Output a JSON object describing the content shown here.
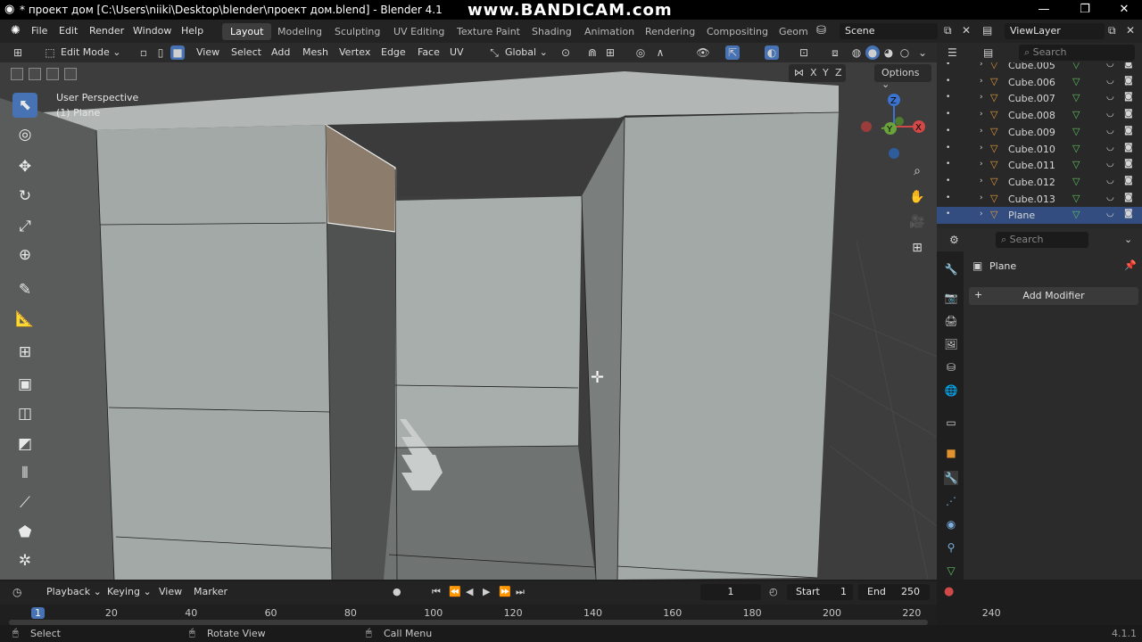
{
  "window": {
    "title": "* проект дом [C:\\Users\\niiki\\Desktop\\blender\\проект дом.blend] - Blender 4.1",
    "watermark": "www.BANDICAM.com"
  },
  "menu": [
    "File",
    "Edit",
    "Render",
    "Window",
    "Help"
  ],
  "workspaces": [
    "Layout",
    "Modeling",
    "Sculpting",
    "UV Editing",
    "Texture Paint",
    "Shading",
    "Animation",
    "Rendering",
    "Compositing",
    "Geom"
  ],
  "active_workspace": "Layout",
  "scene": "Scene",
  "view_layer": "ViewLayer",
  "viewport_header": {
    "mode": "Edit Mode",
    "menus": [
      "View",
      "Select",
      "Add",
      "Mesh",
      "Vertex",
      "Edge",
      "Face",
      "UV"
    ],
    "orientation": "Global",
    "options": "Options",
    "axes": [
      "X",
      "Y",
      "Z"
    ]
  },
  "viewport": {
    "perspective": "User Perspective",
    "object": "(1) Plane"
  },
  "outliner": {
    "search_placeholder": "Search",
    "items": [
      {
        "name": "Cube.005",
        "selected": false
      },
      {
        "name": "Cube.006",
        "selected": false
      },
      {
        "name": "Cube.007",
        "selected": false
      },
      {
        "name": "Cube.008",
        "selected": false
      },
      {
        "name": "Cube.009",
        "selected": false
      },
      {
        "name": "Cube.010",
        "selected": false
      },
      {
        "name": "Cube.011",
        "selected": false
      },
      {
        "name": "Cube.012",
        "selected": false
      },
      {
        "name": "Cube.013",
        "selected": false
      },
      {
        "name": "Plane",
        "selected": true
      }
    ]
  },
  "properties": {
    "search_placeholder": "Search",
    "object_name": "Plane",
    "add_modifier": "Add Modifier"
  },
  "timeline": {
    "menus": [
      "Playback",
      "Keying",
      "View",
      "Marker"
    ],
    "current_frame": "1",
    "start_label": "Start",
    "start": "1",
    "end_label": "End",
    "end": "250",
    "ruler": [
      "1",
      "20",
      "40",
      "60",
      "80",
      "100",
      "120",
      "140",
      "160",
      "180",
      "200",
      "220",
      "240"
    ]
  },
  "statusbar": {
    "select": "Select",
    "rotate": "Rotate View",
    "call_menu": "Call Menu",
    "version": "4.1.1"
  },
  "colors": {
    "accent": "#4772b3",
    "selected_face": "#8c7c6c",
    "wall": "#a4aaa8"
  }
}
